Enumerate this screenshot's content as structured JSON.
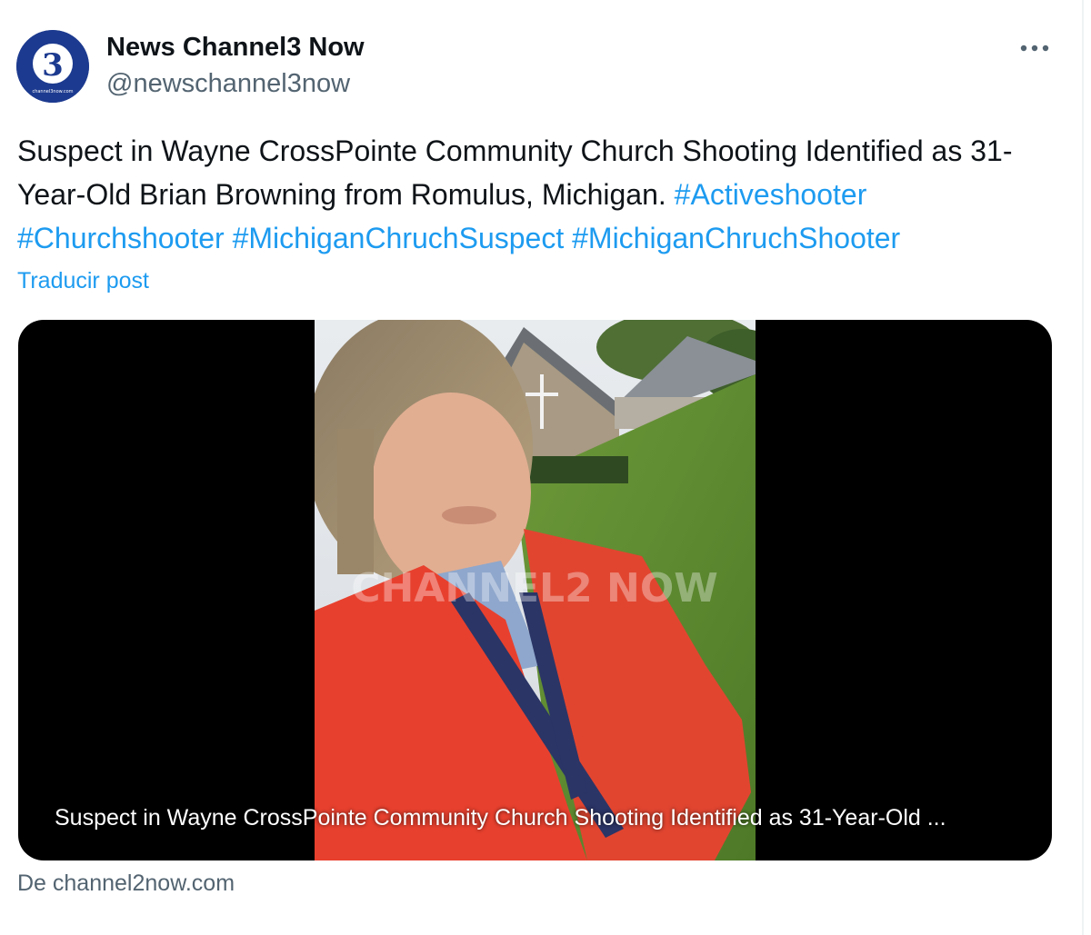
{
  "author": {
    "name": "News Channel3 Now",
    "handle": "@newschannel3now",
    "avatar_text": "channel3now.com",
    "avatar_glyph": "3"
  },
  "menu": {
    "more_icon": "more-horizontal-icon"
  },
  "tweet": {
    "text_plain": "Suspect in Wayne CrossPointe Community Church Shooting Identified as 31-Year-Old Brian Browning from Romulus, Michigan. ",
    "hashtags": [
      "#Activeshooter",
      "#Churchshooter",
      "#MichiganChruchSuspect",
      "#MichiganChruchShooter"
    ],
    "translate_label": "Traducir post"
  },
  "card": {
    "image_watermark": "CHANNEL2 NOW",
    "caption": "Suspect in Wayne CrossPointe Community Church Shooting Identified as 31-Year-Old ...",
    "source_label": "De channel2now.com"
  },
  "colors": {
    "link": "#1d9bf0",
    "text": "#0f1419",
    "muted": "#536471",
    "avatar_bg": "#1c3a8f",
    "jacket": "#e8402e"
  }
}
